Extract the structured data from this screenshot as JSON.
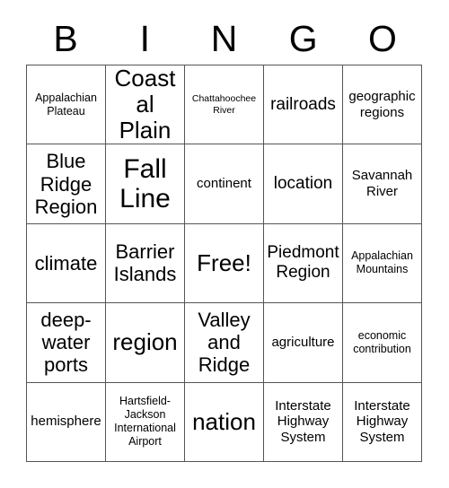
{
  "card": {
    "title": "BINGO",
    "free_space_label": "Free!",
    "background_color": "#ffffff",
    "text_color": "#000000",
    "border_color": "#555555",
    "columns": 5,
    "rows": 5
  },
  "header": {
    "letters": [
      "B",
      "I",
      "N",
      "G",
      "O"
    ]
  },
  "grid": {
    "rows": [
      {
        "cells": [
          {
            "text": "Appalachian Plateau",
            "size": "sm",
            "free": false
          },
          {
            "text": "Coastal Plain",
            "size": "2xl",
            "free": false
          },
          {
            "text": "Chattahoochee River",
            "size": "xs",
            "free": false
          },
          {
            "text": "railroads",
            "size": "lg",
            "free": false
          },
          {
            "text": "geographic regions",
            "size": "md",
            "free": false
          }
        ]
      },
      {
        "cells": [
          {
            "text": "Blue Ridge Region",
            "size": "xl",
            "free": false
          },
          {
            "text": "Fall Line",
            "size": "3xl",
            "free": false
          },
          {
            "text": "continent",
            "size": "md",
            "free": false
          },
          {
            "text": "location",
            "size": "lg",
            "free": false
          },
          {
            "text": "Savannah River",
            "size": "md",
            "free": false
          }
        ]
      },
      {
        "cells": [
          {
            "text": "climate",
            "size": "xl",
            "free": false
          },
          {
            "text": "Barrier Islands",
            "size": "xl",
            "free": false
          },
          {
            "text": "Free!",
            "size": "2xl",
            "free": true
          },
          {
            "text": "Piedmont Region",
            "size": "lg",
            "free": false
          },
          {
            "text": "Appalachian Mountains",
            "size": "sm",
            "free": false
          }
        ]
      },
      {
        "cells": [
          {
            "text": "deep-water ports",
            "size": "xl",
            "free": false
          },
          {
            "text": "region",
            "size": "2xl",
            "free": false
          },
          {
            "text": "Valley and Ridge",
            "size": "xl",
            "free": false
          },
          {
            "text": "agriculture",
            "size": "md",
            "free": false
          },
          {
            "text": "economic contribution",
            "size": "sm",
            "free": false
          }
        ]
      },
      {
        "cells": [
          {
            "text": "hemisphere",
            "size": "md",
            "free": false
          },
          {
            "text": "Hartsfield-Jackson International Airport",
            "size": "sm",
            "free": false
          },
          {
            "text": "nation",
            "size": "2xl",
            "free": false
          },
          {
            "text": "Interstate Highway System",
            "size": "md",
            "free": false
          },
          {
            "text": "Interstate Highway System",
            "size": "md",
            "free": false
          }
        ]
      }
    ]
  }
}
